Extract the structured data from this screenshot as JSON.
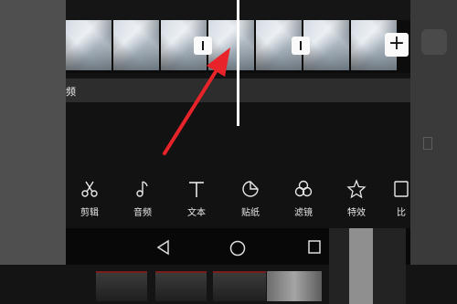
{
  "timeline": {
    "audio_track_label": "频",
    "add_button_label": "+"
  },
  "toolbar": {
    "items": [
      {
        "label": "剪辑",
        "icon": "scissors-icon"
      },
      {
        "label": "音频",
        "icon": "music-note-icon"
      },
      {
        "label": "文本",
        "icon": "text-icon"
      },
      {
        "label": "贴纸",
        "icon": "sticker-icon"
      },
      {
        "label": "滤镜",
        "icon": "filter-icon"
      },
      {
        "label": "特效",
        "icon": "effects-star-icon"
      },
      {
        "label": "比",
        "icon": "ratio-icon"
      }
    ]
  },
  "navbar": {
    "icons": [
      "back-triangle-icon",
      "home-circle-icon",
      "recents-square-icon"
    ]
  },
  "colors": {
    "background": "#121212",
    "playhead": "#ffffff",
    "arrow": "#e8242a"
  }
}
